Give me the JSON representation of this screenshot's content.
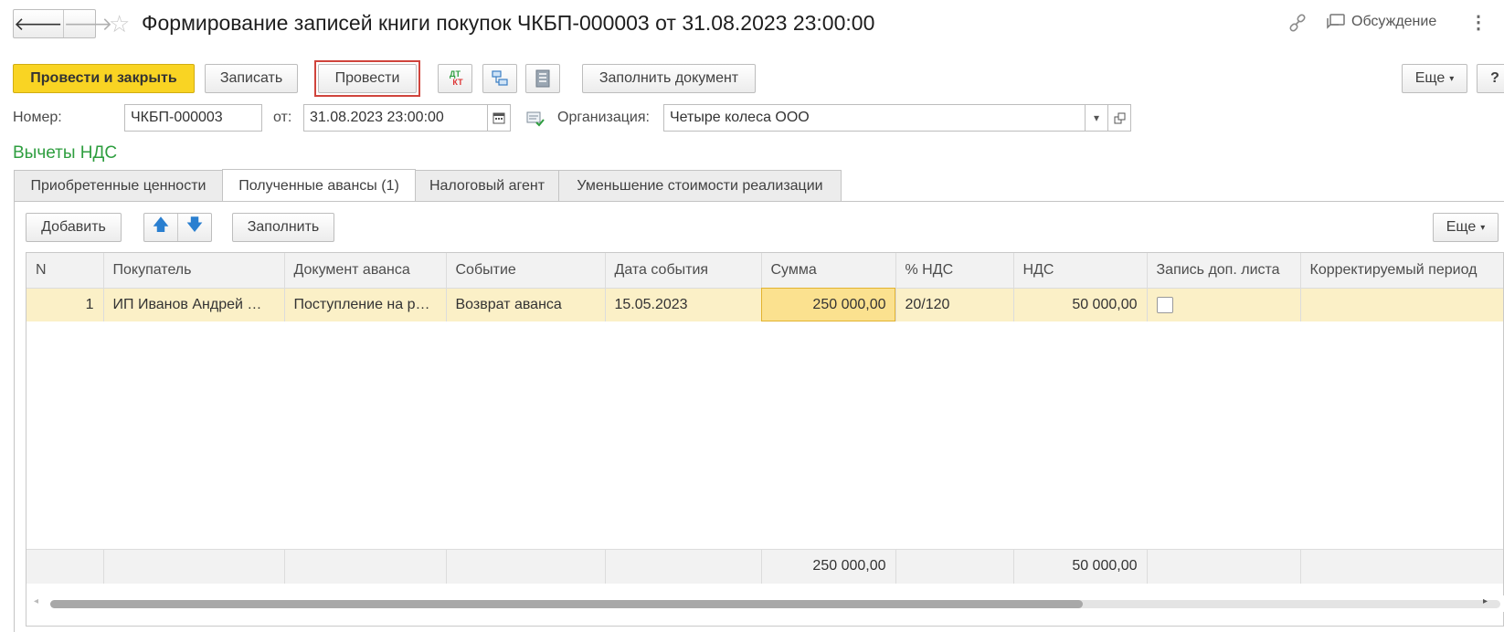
{
  "window": {
    "title": "Формирование записей книги покупок ЧКБП-000003 от 31.08.2023 23:00:00",
    "discussion_label": "Обсуждение"
  },
  "toolbar": {
    "post_close": "Провести и закрыть",
    "save": "Записать",
    "post": "Провести",
    "fill_doc": "Заполнить документ",
    "more": "Еще",
    "help": "?"
  },
  "header": {
    "number_label": "Номер:",
    "number_value": "ЧКБП-000003",
    "date_label": "от:",
    "date_value": "31.08.2023 23:00:00",
    "org_label": "Организация:",
    "org_value": "Четыре колеса ООО"
  },
  "section_title": "Вычеты НДС",
  "tabs": [
    {
      "label": "Приобретенные ценности"
    },
    {
      "label": "Полученные авансы (1)"
    },
    {
      "label": "Налоговый агент"
    },
    {
      "label": "Уменьшение стоимости реализации"
    }
  ],
  "table_toolbar": {
    "add": "Добавить",
    "fill": "Заполнить",
    "more": "Еще"
  },
  "table": {
    "columns": [
      "N",
      "Покупатель",
      "Документ аванса",
      "Событие",
      "Дата события",
      "Сумма",
      "% НДС",
      "НДС",
      "Запись доп. листа",
      "Корректируемый период"
    ],
    "rows": [
      {
        "n": "1",
        "buyer": "ИП Иванов Андрей …",
        "doc": "Поступление на р…",
        "event": "Возврат аванса",
        "date": "15.05.2023",
        "sum": "250 000,00",
        "rate": "20/120",
        "vat": "50 000,00",
        "extra_sheet": false,
        "period": ""
      }
    ],
    "totals": {
      "sum": "250 000,00",
      "vat": "50 000,00"
    }
  },
  "colors": {
    "primary_button": "#f9d423",
    "section_title": "#2e9e3f",
    "row_highlight": "#fbf0c7",
    "active_cell": "#fbe18f",
    "focus_border": "#d0443c"
  }
}
